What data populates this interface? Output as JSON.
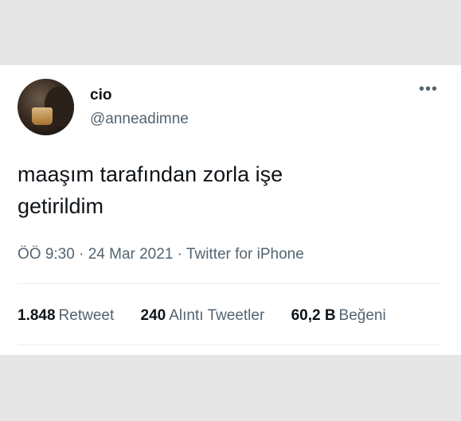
{
  "tweet": {
    "display_name": "cio",
    "handle": "@anneadimne",
    "more_icon": "more-horizontal-icon",
    "text_line1": "maaşım tarafından zorla işe",
    "text_line2": "getirildim",
    "meta": "ÖÖ 9:30 · 24 Mar 2021 · Twitter for iPhone",
    "stats": [
      {
        "value": "1.848",
        "label": "Retweet"
      },
      {
        "value": "240",
        "label": "Alıntı Tweetler"
      },
      {
        "value": "60,2 B",
        "label": "Beğeni"
      }
    ]
  }
}
